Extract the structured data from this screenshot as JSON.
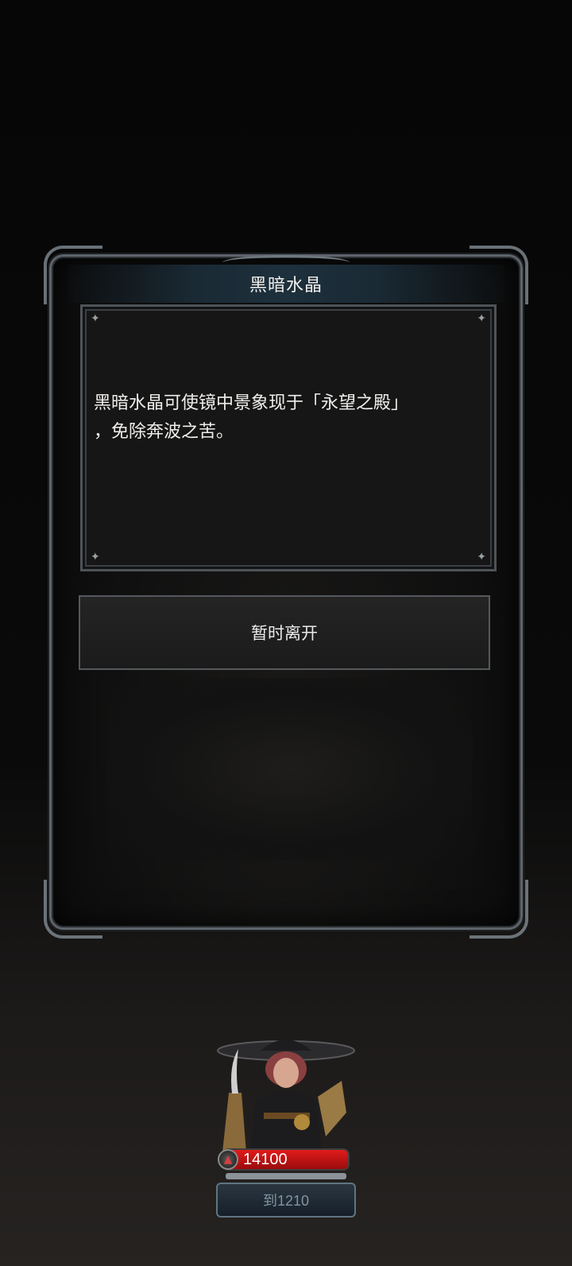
{
  "dialog": {
    "title": "黑暗水晶",
    "description": "黑暗水晶可使镜中景象现于「永望之殿」\n，免除奔波之苦。",
    "leave_label": "暂时离开"
  },
  "player": {
    "hp": "14100",
    "level_label": "到1210"
  },
  "icons": {
    "sparkle": "sparkle-icon",
    "hp": "blade-icon"
  },
  "colors": {
    "hp_bar": "#c81212",
    "frame": "#5d646a",
    "title_bar": "#1d303c"
  }
}
